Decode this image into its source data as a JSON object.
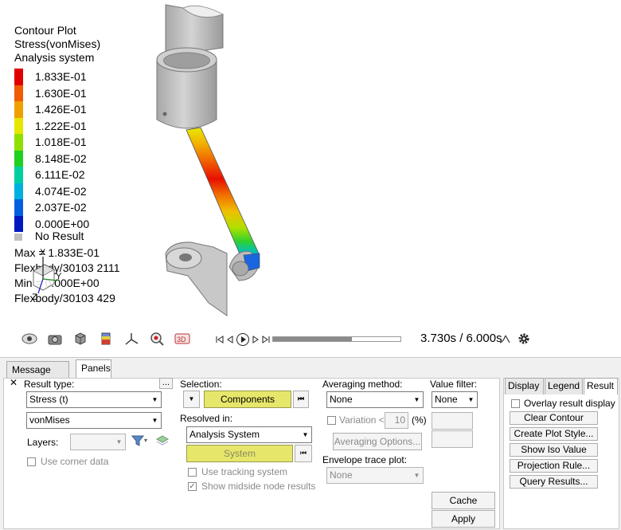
{
  "legend": {
    "title_lines": [
      "Contour Plot",
      "Stress(vonMises)",
      "Analysis system"
    ],
    "entries": [
      {
        "label": "1.833E-01",
        "color": "#e00000"
      },
      {
        "label": "1.630E-01",
        "color": "#f05a00"
      },
      {
        "label": "1.426E-01",
        "color": "#f0a000"
      },
      {
        "label": "1.222E-01",
        "color": "#e6e600"
      },
      {
        "label": "1.018E-01",
        "color": "#8ee000"
      },
      {
        "label": "8.148E-02",
        "color": "#20d020"
      },
      {
        "label": "6.111E-02",
        "color": "#00d0a0"
      },
      {
        "label": "4.074E-02",
        "color": "#00b0e0"
      },
      {
        "label": "2.037E-02",
        "color": "#0060e0"
      },
      {
        "label": "0.000E+00",
        "color": "#0018c0"
      }
    ],
    "no_result": "No Result",
    "no_result_color": "#c0c0c0",
    "max_line": "Max =  1.833E-01",
    "max_entity": "Flexbody/30103 2111",
    "min_line": "Min = 0.000E+00",
    "min_entity": "Flexbody/30103 429"
  },
  "animation": {
    "time": "3.730s / 6.000s",
    "progress": 0.62
  },
  "tabs": {
    "bottom": [
      "Message Log",
      "Panels"
    ],
    "active_bottom": "Panels",
    "right": [
      "Display",
      "Legend",
      "Result"
    ],
    "active_right": "Result"
  },
  "panel": {
    "result_type_label": "Result type:",
    "ellipsis": "...",
    "result_type": "Stress (t)",
    "component": "vonMises",
    "layers_label": "Layers:",
    "use_corner": "Use corner data",
    "selection_label": "Selection:",
    "components_btn": "Components",
    "resolved_label": "Resolved in:",
    "resolved": "Analysis System",
    "system_btn": "System",
    "use_tracking": "Use tracking system",
    "show_midside": "Show midside node results",
    "avg_label": "Averaging method:",
    "avg": "None",
    "variation": "Variation <",
    "variation_value": "10",
    "variation_unit": "(%)",
    "avg_options": "Averaging Options...",
    "envelope_label": "Envelope trace plot:",
    "envelope": "None",
    "value_filter_label": "Value filter:",
    "value_filter": "None",
    "cache": "Cache",
    "apply": "Apply",
    "overlay": "Overlay result display",
    "clear_contour": "Clear Contour",
    "create_style": "Create Plot Style...",
    "show_iso": "Show Iso Value",
    "projection": "Projection Rule...",
    "query": "Query Results..."
  }
}
